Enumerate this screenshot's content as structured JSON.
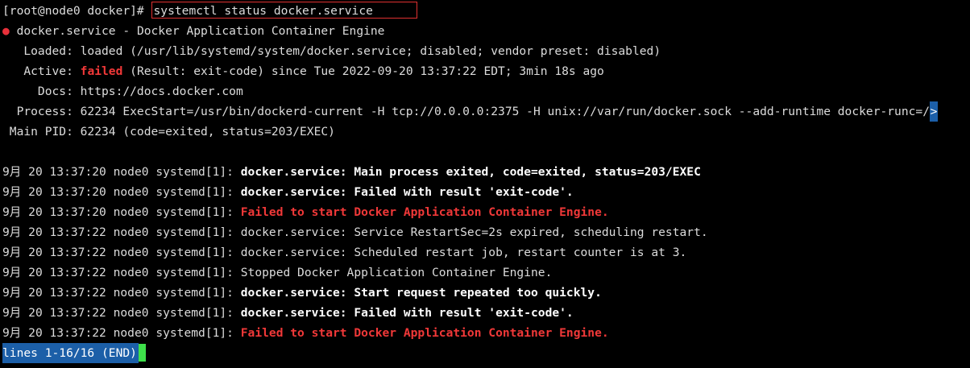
{
  "terminal": {
    "prompt": "[root@node0 docker]# ",
    "command": "systemctl status docker.service",
    "unit_line": {
      "bullet": "●",
      "text": " docker.service - Docker Application Container Engine"
    },
    "loaded": "   Loaded: loaded (/usr/lib/systemd/system/docker.service; disabled; vendor preset: disabled)",
    "active": {
      "label": "   Active: ",
      "state": "failed",
      "rest": " (Result: exit-code) since Tue 2022-09-20 13:37:22 EDT; 3min 18s ago"
    },
    "docs": "     Docs: https://docs.docker.com",
    "process": {
      "text": "  Process: 62234 ExecStart=/usr/bin/dockerd-current -H tcp://0.0.0.0:2375 -H unix://var/run/docker.sock --add-runtime docker-runc=/",
      "truncation_marker": ">"
    },
    "main_pid": " Main PID: 62234 (code=exited, status=203/EXEC)",
    "logs": [
      {
        "prefix": "9月 20 13:37:20 node0 systemd[1]: ",
        "message": "docker.service: Main process exited, code=exited, status=203/EXEC",
        "style": "bold"
      },
      {
        "prefix": "9月 20 13:37:20 node0 systemd[1]: ",
        "message": "docker.service: Failed with result 'exit-code'.",
        "style": "bold"
      },
      {
        "prefix": "9月 20 13:37:20 node0 systemd[1]: ",
        "message": "Failed to start Docker Application Container Engine.",
        "style": "red-bold"
      },
      {
        "prefix": "9月 20 13:37:22 node0 systemd[1]: ",
        "message": "docker.service: Service RestartSec=2s expired, scheduling restart.",
        "style": "normal"
      },
      {
        "prefix": "9月 20 13:37:22 node0 systemd[1]: ",
        "message": "docker.service: Scheduled restart job, restart counter is at 3.",
        "style": "normal"
      },
      {
        "prefix": "9月 20 13:37:22 node0 systemd[1]: ",
        "message": "Stopped Docker Application Container Engine.",
        "style": "normal"
      },
      {
        "prefix": "9月 20 13:37:22 node0 systemd[1]: ",
        "message": "docker.service: Start request repeated too quickly.",
        "style": "bold"
      },
      {
        "prefix": "9月 20 13:37:22 node0 systemd[1]: ",
        "message": "docker.service: Failed with result 'exit-code'.",
        "style": "bold"
      },
      {
        "prefix": "9月 20 13:37:22 node0 systemd[1]: ",
        "message": "Failed to start Docker Application Container Engine.",
        "style": "red-bold"
      }
    ],
    "pager_status": "lines 1-16/16 (END)"
  },
  "colors": {
    "background": "#000000",
    "text": "#dcdcdc",
    "error_red": "#f03838",
    "highlight_box": "#e03030",
    "pager_bg": "#1c5fa8",
    "cursor": "#3ee04a"
  }
}
